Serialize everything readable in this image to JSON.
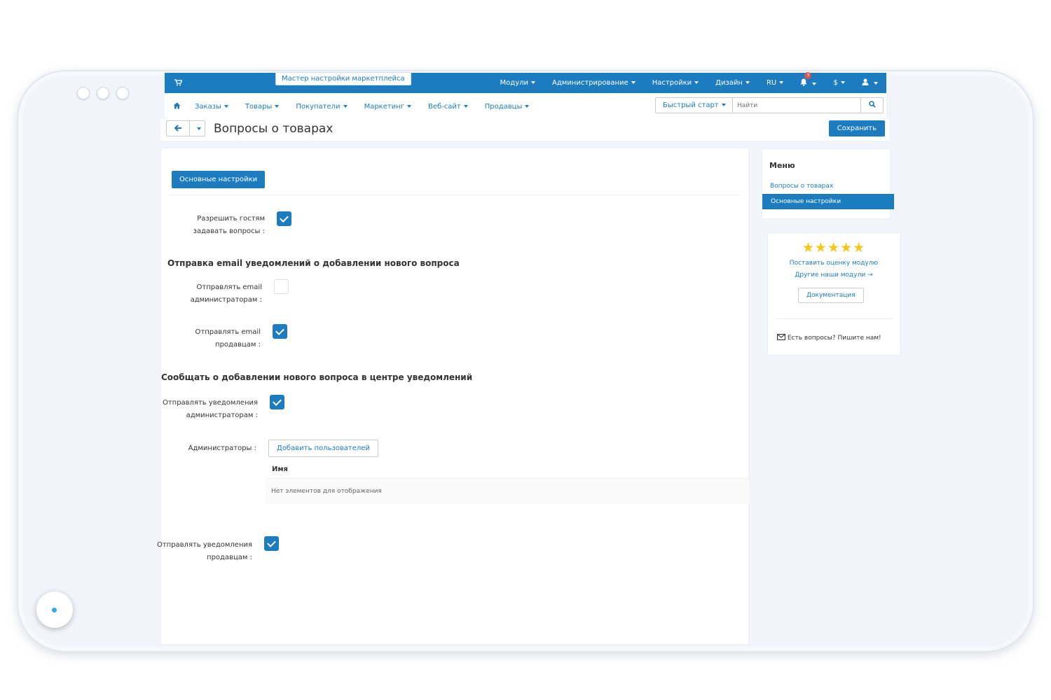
{
  "topbar": {
    "wizard_label": "Мастер настройки маркетплейса",
    "menu": [
      "Модули",
      "Администрирование",
      "Настройки",
      "Дизайн",
      "RU"
    ],
    "notification_count": "3",
    "currency": "$"
  },
  "nav": {
    "items": [
      "Заказы",
      "Товары",
      "Покупатели",
      "Маркетинг",
      "Веб-сайт",
      "Продавцы"
    ],
    "quick_start": "Быстрый старт",
    "search_placeholder": "Найти"
  },
  "page": {
    "title": "Вопросы о товарах",
    "save_label": "Сохранить"
  },
  "form": {
    "tab_label": "Основные настройки",
    "allow_guests_line1": "Разрешить гостям",
    "allow_guests_line2": "задавать вопросы :",
    "section_email": "Отправка email уведомлений о добавлении нового вопроса",
    "email_admins_line1": "Отправлять email",
    "email_admins_line2": "администраторам :",
    "email_vendors_line1": "Отправлять email",
    "email_vendors_line2": "продавцам :",
    "section_center": "Сообщать о добавлении нового вопроса в центре уведомлений",
    "notify_admins_line1": "Отправлять уведомления",
    "notify_admins_line2": "администраторам :",
    "admins_label": "Администраторы :",
    "add_users_label": "Добавить пользователей",
    "table_header_name": "Имя",
    "table_empty": "Нет элементов для отображения",
    "notify_vendors_line1": "Отправлять уведомления",
    "notify_vendors_line2": "продавцам :",
    "checks": {
      "allow_guests": true,
      "email_admins": false,
      "email_vendors": true,
      "notify_admins": true,
      "notify_vendors": true
    }
  },
  "sidebar": {
    "menu_title": "Меню",
    "item_questions": "Вопросы о товарах",
    "item_settings": "Основные настройки",
    "rating_stars": 5,
    "rate_link": "Поставить оценку модулю",
    "other_modules": "Другие наши модули →",
    "docs_label": "Документация",
    "contact_text": "Есть вопросы? Пишите нам!"
  },
  "colors": {
    "accent": "#1d7bbf",
    "star": "#f5c518",
    "badge": "#d9534f"
  }
}
